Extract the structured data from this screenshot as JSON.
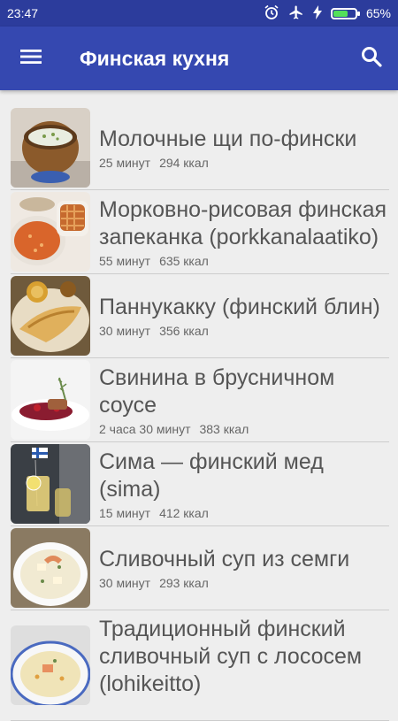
{
  "status": {
    "time": "23:47",
    "battery": "65%",
    "battery_level": 0.65
  },
  "appbar": {
    "title": "Финская кухня"
  },
  "recipes": [
    {
      "name": "Молочные щи по-фински",
      "time": "25 минут",
      "kcal": "294 ккал"
    },
    {
      "name": "Морковно-рисовая финская запеканка (porkkanalaatiko)",
      "time": "55 минут",
      "kcal": "635 ккал"
    },
    {
      "name": "Паннукакку (финский блин)",
      "time": "30 минут",
      "kcal": "356 ккал"
    },
    {
      "name": "Свинина в брусничном соусе",
      "time": "2 часа 30 минут",
      "kcal": "383 ккал"
    },
    {
      "name": "Сима — финский мед (sima)",
      "time": "15 минут",
      "kcal": "412 ккал"
    },
    {
      "name": "Сливочный суп из семги",
      "time": "30 минут",
      "kcal": "293 ккал"
    },
    {
      "name": "Традиционный финский сливочный суп с лососем (lohikeitto)",
      "time": "",
      "kcal": ""
    }
  ]
}
